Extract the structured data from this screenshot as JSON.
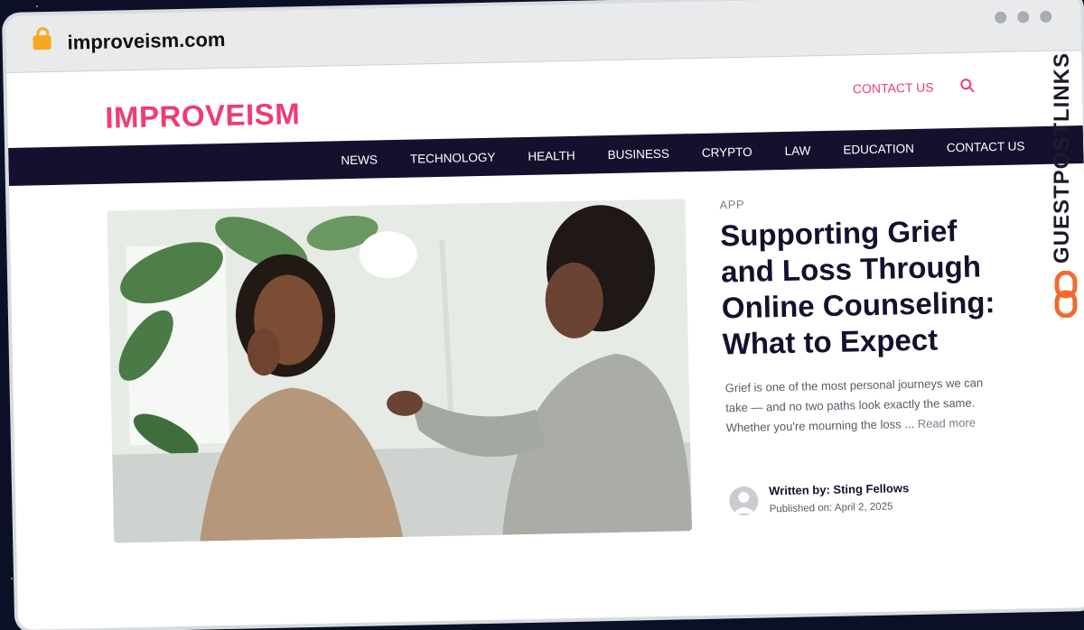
{
  "browser": {
    "url": "improveism.com",
    "lock_icon": "lock-icon"
  },
  "site": {
    "logo": "IMPROVEISM",
    "top_contact": "CONTACT US",
    "search_icon": "search-icon"
  },
  "nav": {
    "items": [
      "NEWS",
      "TECHNOLOGY",
      "HEALTH",
      "BUSINESS",
      "CRYPTO",
      "LAW",
      "EDUCATION",
      "CONTACT US"
    ]
  },
  "article": {
    "category": "APP",
    "title": "Supporting Grief and Loss Through Online Counseling: What to Expect",
    "excerpt": "Grief is one of the most personal journeys we can take — and no two paths look exactly the same. Whether you're mourning the loss ...",
    "read_more": "Read more",
    "author_line": "Written by: Sting Fellows",
    "published_line": "Published on: April 2, 2025"
  },
  "watermark": {
    "text": "GUESTPOSTLINKS"
  },
  "colors": {
    "accent": "#ef3c72",
    "navbar": "#15102e",
    "brand_orange": "#f26a2e"
  }
}
